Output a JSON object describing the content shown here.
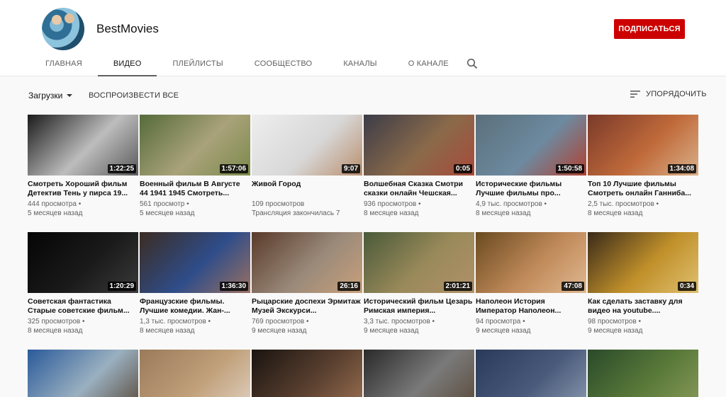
{
  "channel": {
    "name": "BestMovies",
    "subscribe_label": "ПОДПИСАТЬСЯ"
  },
  "tabs": [
    {
      "label": "ГЛАВНАЯ"
    },
    {
      "label": "ВИДЕО",
      "active": true
    },
    {
      "label": "ПЛЕЙЛИСТЫ"
    },
    {
      "label": "СООБЩЕСТВО"
    },
    {
      "label": "КАНАЛЫ"
    },
    {
      "label": "О КАНАЛЕ"
    }
  ],
  "filters": {
    "uploads_label": "Загрузки",
    "play_all_label": "ВОСПРОИЗВЕСТИ ВСЕ",
    "sort_label": "УПОРЯДОЧИТЬ"
  },
  "videos": [
    {
      "title": "Смотреть Хороший фильм Детектив Тень у пирса 19...",
      "views": "444 просмотра •",
      "age": "5 месяцев назад",
      "duration": "1:22:25",
      "thumb": [
        "#1b1b1b",
        "#bdbdbd",
        "#5a5a5a"
      ]
    },
    {
      "title": "Военный фильм В Августе 44 1941 1945 Смотреть...",
      "views": "561 просмотр •",
      "age": "5 месяцев назад",
      "duration": "1:57:06",
      "thumb": [
        "#556b3a",
        "#a9a27a",
        "#7c8a4c"
      ]
    },
    {
      "title": "Живой Город",
      "views": "109 просмотров",
      "age": "Трансляция закончилась 7",
      "duration": "9:07",
      "thumb": [
        "#eeeeee",
        "#d8d8d8",
        "#b98f6e"
      ]
    },
    {
      "title": "Волшебная Сказка Смотри сказки онлайн Чешская...",
      "views": "936 просмотров •",
      "age": "8 месяцев назад",
      "duration": "0:05",
      "thumb": [
        "#3c3c48",
        "#8a6a4a",
        "#a84a3a"
      ]
    },
    {
      "title": "Исторические фильмы Лучшие фильмы про...",
      "views": "4,9 тыс. просмотров •",
      "age": "8 месяцев назад",
      "duration": "1:50:58",
      "thumb": [
        "#5b6f7a",
        "#6d8aa0",
        "#b04030"
      ]
    },
    {
      "title": "Топ 10 Лучшие фильмы Смотреть онлайн Ганниба...",
      "views": "2,5 тыс. просмотров •",
      "age": "8 месяцев назад",
      "duration": "1:34:08",
      "thumb": [
        "#7a3a2a",
        "#c06a3a",
        "#d9b18a"
      ]
    },
    {
      "title": "Советская фантастика Старые советские фильм...",
      "views": "325 просмотров •",
      "age": "8 месяцев назад",
      "duration": "1:20:29",
      "thumb": [
        "#050505",
        "#1a1a1a",
        "#3a3a3a"
      ]
    },
    {
      "title": "Французские фильмы. Лучшие комедии. Жан-...",
      "views": "1,3 тыс. просмотров •",
      "age": "8 месяцев назад",
      "duration": "1:36:30",
      "thumb": [
        "#3b2c22",
        "#2f4d8a",
        "#9a7060"
      ]
    },
    {
      "title": "Рыцарские доспехи Эрмитаж Музей Экскурси...",
      "views": "769 просмотров •",
      "age": "9 месяцев назад",
      "duration": "26:16",
      "thumb": [
        "#5a3a2a",
        "#9a8a7a",
        "#c9a07a"
      ]
    },
    {
      "title": "Исторический фильм Цезарь Римская империя...",
      "views": "3,3 тыс. просмотров •",
      "age": "9 месяцев назад",
      "duration": "2:01:21",
      "thumb": [
        "#4a5a3a",
        "#9a8a5a",
        "#b0906a"
      ]
    },
    {
      "title": "Наполеон История Император Наполеон...",
      "views": "94 просмотра •",
      "age": "9 месяцев назад",
      "duration": "47:08",
      "thumb": [
        "#6a4a20",
        "#c08a5a",
        "#e0b890"
      ]
    },
    {
      "title": "Как сделать заставку для видео на youtube....",
      "views": "98 просмотров •",
      "age": "9 месяцев назад",
      "duration": "0:34",
      "thumb": [
        "#3a2a1a",
        "#c0902a",
        "#e0c070"
      ]
    },
    {
      "title": "",
      "views": "",
      "age": "",
      "duration": "",
      "thumb": [
        "#2a5a9a",
        "#9ab0c0",
        "#5a4a3a"
      ]
    },
    {
      "title": "",
      "views": "",
      "age": "",
      "duration": "",
      "thumb": [
        "#9a7a5a",
        "#c0a07a",
        "#e0d0c0"
      ]
    },
    {
      "title": "",
      "views": "",
      "age": "",
      "duration": "",
      "thumb": [
        "#1a1410",
        "#5a4030",
        "#9a7050"
      ]
    },
    {
      "title": "",
      "views": "",
      "age": "",
      "duration": "",
      "thumb": [
        "#2a2a2a",
        "#7a7a7a",
        "#5a4a3a"
      ]
    },
    {
      "title": "",
      "views": "",
      "age": "",
      "duration": "",
      "thumb": [
        "#2a3a5a",
        "#4a5a7a",
        "#8a9ab0"
      ]
    },
    {
      "title": "",
      "views": "",
      "age": "",
      "duration": "",
      "thumb": [
        "#2a4a2a",
        "#5a7a3a",
        "#8a9a5a"
      ]
    }
  ],
  "colors": {
    "subscribe_red": "#cc0000",
    "text_secondary": "#606060",
    "background": "#f9f9f9"
  }
}
